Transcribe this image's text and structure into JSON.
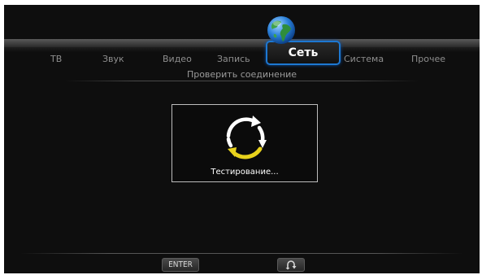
{
  "menu": {
    "tabs": [
      {
        "label": "ТВ"
      },
      {
        "label": "Звук"
      },
      {
        "label": "Видео"
      },
      {
        "label": "Запись"
      },
      {
        "label": "Сеть",
        "selected": true
      },
      {
        "label": "Система"
      },
      {
        "label": "Прочее"
      }
    ],
    "selected_tab": "Сеть",
    "selected_icon": "globe-icon"
  },
  "section": {
    "subtitle": "Проверить соединение"
  },
  "dialog": {
    "status": "Тестирование...",
    "icon": "refresh-spinner-icon",
    "arrow_colors": {
      "top": "#ffffff",
      "bottom": "#e8d21c"
    }
  },
  "footer": {
    "enter_label": "ENTER",
    "return_icon": "return-arrow-icon"
  },
  "colors": {
    "background": "#0e0e0e",
    "accent": "#1d78d2",
    "text_dim": "#8e8e8e"
  }
}
